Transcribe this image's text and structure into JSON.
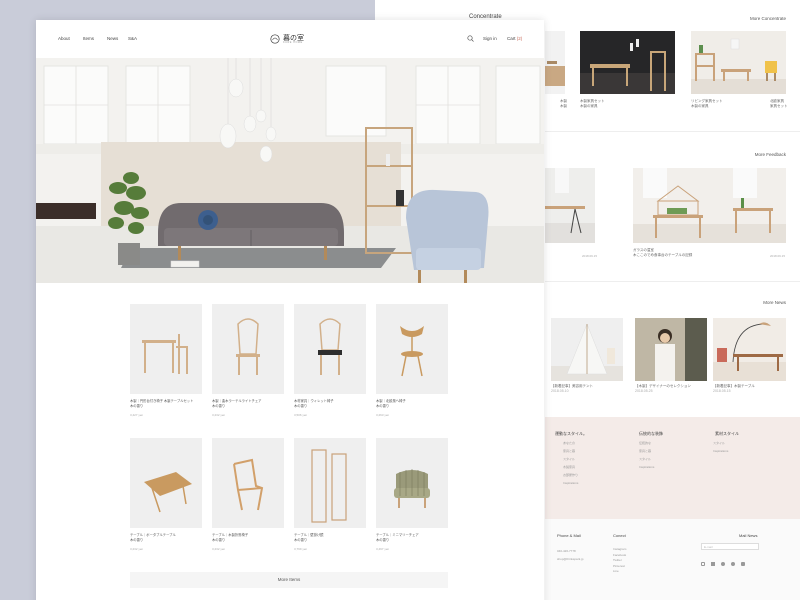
{
  "nav": {
    "links": [
      "About",
      "Items",
      "News",
      "S&A"
    ],
    "logo_text": "暮の室",
    "logo_sub": "KURE HOME",
    "sign_in": "Sign in",
    "cart": "Cart",
    "cart_count": "(2)"
  },
  "products": [
    {
      "name": "木製｜円形台付き椅子 木製テーブルセット",
      "sub": "木の香り",
      "price": "3,427 yen"
    },
    {
      "name": "木製｜曲木ラーテルライトチェア",
      "sub": "木の香り",
      "price": "3,232 yen"
    },
    {
      "name": "木材家具｜ウィレット椅子",
      "sub": "木の香り",
      "price": "3,506 yen"
    },
    {
      "name": "木製｜北欧風ヘ椅子",
      "sub": "木の香り",
      "price": "3,263 yen"
    },
    {
      "name": "テーブル｜ポータブルテーブル",
      "sub": "木の香り",
      "price": "3,232 yen"
    },
    {
      "name": "テーブル｜木製折畳椅子",
      "sub": "木の香り",
      "price": "3,232 yen"
    },
    {
      "name": "テーブル｜壁掛け鏡",
      "sub": "木の香り",
      "price": "3,799 yen"
    },
    {
      "name": "テーブル｜ミニマリーチェア",
      "sub": "木の香り",
      "price": "3,497 yen"
    }
  ],
  "more_items": "More Items",
  "back": {
    "concentrate": {
      "title": "Concentrate",
      "more": "More Concentrate",
      "captions": [
        {
          "a": "木製",
          "b": "木製"
        },
        {
          "a": "木製家具セット",
          "b": "木製の家具"
        },
        {
          "a": "リビング家具セット",
          "b": "木製の家具"
        }
      ],
      "right_caps": [
        "北欧家具",
        "家具セット"
      ]
    },
    "feedback": {
      "more": "More Feedback",
      "captions": [
        {
          "a": "",
          "b": "2018.09.15"
        },
        {
          "a": "ガラスの温室",
          "b": "木ここのでめ食事台のテーブルの記録",
          "c": "2018.09.15"
        }
      ]
    },
    "news": {
      "more": "More News",
      "captions": [
        {
          "a": "【新着記事】美容用テント",
          "b": "2018.05.10"
        },
        {
          "a": "【木製】デザイナーのセレクション",
          "b": "2018.05.25"
        },
        {
          "a": "【新着記事】木製テーブル",
          "b": "2018.05.15"
        }
      ]
    },
    "footer_cols": [
      {
        "head": "運動なスタイル。",
        "items": [
          "あなたの",
          "家具と暮",
          "スタイル",
          "木製家具",
          "お部屋作り",
          "Inspirations"
        ]
      },
      {
        "head": "伝統的な装飾",
        "items": [
          "伝統的な",
          "家具と暮",
          "スタイル",
          "Inspirations"
        ]
      },
      {
        "head": "素材スタイル",
        "items": [
          "スタイル",
          "Inspirations"
        ]
      }
    ],
    "phone_mail": {
      "head": "Phone & Mail",
      "items": [
        "040-426-7778",
        "shop@thinkspark.jp"
      ]
    },
    "connect": {
      "head": "Conect",
      "items": [
        "Instagram",
        "Facebook",
        "Twitter",
        "Pinterest",
        "Line"
      ]
    },
    "mail_news": {
      "head": "Mail News",
      "placeholder": "E-mail"
    }
  },
  "colors": {
    "accent": "#c96a5a",
    "pink": "#f4ebe8"
  }
}
